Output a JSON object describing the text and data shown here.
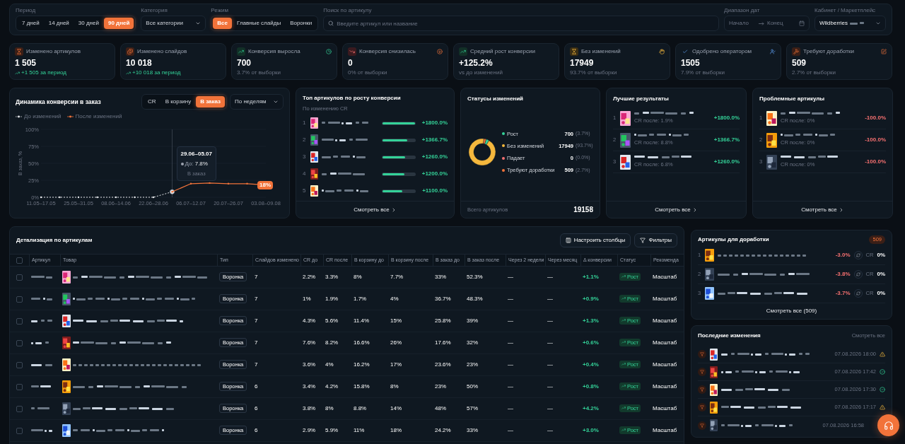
{
  "filters": {
    "period": {
      "label": "Период",
      "options": [
        {
          "label": "7 дней",
          "selected": false
        },
        {
          "label": "14 дней",
          "selected": false
        },
        {
          "label": "30 дней",
          "selected": false
        },
        {
          "label": "90 дней",
          "selected": true
        }
      ]
    },
    "category": {
      "label": "Категория",
      "value": "Все категории"
    },
    "mode": {
      "label": "Режим",
      "options": [
        {
          "label": "Все",
          "selected": true
        },
        {
          "label": "Главные слайды",
          "selected": false
        },
        {
          "label": "Воронки",
          "selected": false
        }
      ]
    },
    "search": {
      "label": "Поиск по артикулу",
      "placeholder": "Введите артикул или название"
    },
    "dates": {
      "label": "Диапазон дат",
      "start_placeholder": "Начало",
      "end_placeholder": "Конец"
    },
    "cabinet": {
      "label": "Кабинет / Маркетплейс",
      "value": "Wildberries"
    }
  },
  "stats": [
    {
      "label": "Изменено артикулов",
      "value": "1 505",
      "sub": "+1 505 за период",
      "kind": "growth"
    },
    {
      "label": "Изменено слайдов",
      "value": "10 018",
      "sub": "+10 018 за период",
      "kind": "growth"
    },
    {
      "label": "Конверсия выросла",
      "value": "700",
      "sub": "3.7% от выборки",
      "kind": "muted"
    },
    {
      "label": "Конверсия снизилась",
      "value": "0",
      "sub": "0% от выборки",
      "kind": "muted"
    },
    {
      "label": "Средний рост конверсии",
      "value": "+125.2%",
      "sub": "vs до изменений",
      "kind": "muted"
    },
    {
      "label": "Без изменений",
      "value": "17949",
      "sub": "93.7% от выборки",
      "kind": "muted"
    },
    {
      "label": "Одобрено оператором",
      "value": "1505",
      "sub": "7.9% от выборки",
      "kind": "muted"
    },
    {
      "label": "Требуют доработки",
      "value": "509",
      "sub": "2.7% от выборки",
      "kind": "muted"
    }
  ],
  "dynamics": {
    "title": "Динамика конверсии в заказ",
    "tabs": [
      {
        "label": "CR",
        "selected": false
      },
      {
        "label": "В корзину",
        "selected": false
      },
      {
        "label": "В заказ",
        "selected": true
      }
    ],
    "grouping": "По неделям",
    "tooltip": {
      "title": "29.06–05.07",
      "series_label": "До:",
      "value": "7.8%",
      "metric": "В заказ"
    },
    "chart_data": {
      "type": "line",
      "ylabel": "В заказ, %",
      "ylim": [
        0,
        100
      ],
      "categories": [
        "11.05–17.05",
        null,
        "25.05–31.05",
        null,
        "08.06–14.06",
        null,
        "22.06–28.06",
        null,
        "06.07–12.07",
        null,
        "20.07–26.07",
        null,
        "03.08–09.08"
      ],
      "yticks": [
        {
          "value": 0,
          "label": "0%"
        },
        {
          "value": 25,
          "label": "25%"
        },
        {
          "value": 50,
          "label": "50%"
        },
        {
          "value": 75,
          "label": "75%"
        },
        {
          "value": 100,
          "label": "100%"
        }
      ],
      "series": [
        {
          "name": "До изменений",
          "color": "#e5e7eb",
          "line_style": "dashed",
          "values": [
            0,
            0,
            0,
            0,
            0,
            0,
            0,
            8,
            null,
            null,
            null,
            null,
            null
          ]
        },
        {
          "name": "После изменений",
          "color": "#f2733a",
          "line_style": "solid",
          "values": [
            null,
            null,
            null,
            null,
            null,
            null,
            null,
            8,
            20,
            21,
            20,
            20,
            18
          ]
        }
      ],
      "annotations": [
        {
          "x": "03.08–09.08",
          "y": 18,
          "text": "18%"
        }
      ]
    }
  },
  "top_articles": {
    "title": "Топ артикулов по росту конверсии",
    "subtitle": "По изменению CR",
    "footer": "Смотреть все",
    "items": [
      {
        "rank": "1",
        "value": "+1800.0%",
        "level": 1
      },
      {
        "rank": "2",
        "value": "+1366.7%",
        "level": 0.76
      },
      {
        "rank": "3",
        "value": "+1260.0%",
        "level": 0.7
      },
      {
        "rank": "4",
        "value": "+1200.0%",
        "level": 0.67
      },
      {
        "rank": "5",
        "value": "+1100.0%",
        "level": 0.61
      }
    ]
  },
  "statuses": {
    "title": "Статусы изменений",
    "chart_data": {
      "type": "donut",
      "categories": [
        "Рост",
        "Без изменений",
        "Падает",
        "Требуют доработки"
      ],
      "values": [
        3.7,
        93.7,
        0,
        2.7
      ]
    },
    "legend": [
      {
        "count": "700",
        "share": "(3.7%)",
        "color": "#34d399"
      },
      {
        "count": "17949",
        "share": "(93.7%)",
        "color": "#f5b83d"
      },
      {
        "count": "0",
        "share": "(0.0%)",
        "color": "#f87171"
      },
      {
        "count": "509",
        "share": "(2.7%)",
        "color": "#f2733a"
      }
    ],
    "total_label": "Всего артикулов",
    "total": "19158"
  },
  "best": {
    "title": "Лучшие результаты",
    "footer": "Смотреть все",
    "kind": "growth",
    "items": [
      {
        "rank": "1",
        "cr": "CR после: 1.9%",
        "value": "+1800.0%"
      },
      {
        "rank": "2",
        "cr": "CR после: 8.8%",
        "value": "+1366.7%"
      },
      {
        "rank": "3",
        "cr": "CR после: 6.8%",
        "value": "+1260.0%"
      }
    ]
  },
  "problems": {
    "title": "Проблемные артикулы",
    "footer": "Смотреть все",
    "kind": "decline",
    "items": [
      {
        "rank": "1",
        "cr": "CR после: 0%",
        "value": "-100.0%"
      },
      {
        "rank": "2",
        "cr": "CR после: 0%",
        "value": "-100.0%"
      },
      {
        "rank": "3",
        "cr": "CR после: 0%",
        "value": "-100.0%"
      }
    ]
  },
  "details": {
    "title": "Детализация по артикулам",
    "buttons": [
      "Настроить столбцы",
      "Фильтры"
    ],
    "all_checked": false,
    "columns": [
      "Артикул",
      "Товар",
      "Тип",
      "Слайдов изменено",
      "CR до",
      "CR после",
      "В корзину до",
      "В корзину после",
      "В заказ до",
      "В заказ после",
      "Через 2 недели",
      "Через месяц",
      "Δ конверсии",
      "Статус",
      "Рекоменда"
    ],
    "rows": [
      {
        "checked": false,
        "kind": "growth",
        "cells": [
          null,
          null,
          "Воронка",
          "7",
          "2.2%",
          "3.3%",
          "8%",
          "7.7%",
          "33%",
          "52.3%",
          "—",
          "—",
          "+1.1%",
          "Рост",
          "Масштаб"
        ]
      },
      {
        "checked": false,
        "kind": "growth",
        "cells": [
          null,
          null,
          "Воронка",
          "7",
          "1%",
          "1.9%",
          "1.7%",
          "4%",
          "36.7%",
          "48.3%",
          "—",
          "—",
          "+0.9%",
          "Рост",
          "Масштаб"
        ]
      },
      {
        "checked": false,
        "kind": "growth",
        "cells": [
          null,
          null,
          "Воронка",
          "7",
          "4.3%",
          "5.6%",
          "11.4%",
          "15%",
          "25.8%",
          "39%",
          "—",
          "—",
          "+1.3%",
          "Рост",
          "Масштаб"
        ]
      },
      {
        "checked": false,
        "kind": "growth",
        "cells": [
          null,
          null,
          "Воронка",
          "7",
          "7.6%",
          "8.2%",
          "16.6%",
          "26%",
          "17.6%",
          "32%",
          "—",
          "—",
          "+0.6%",
          "Рост",
          "Масштаб"
        ]
      },
      {
        "checked": false,
        "kind": "growth",
        "cells": [
          null,
          null,
          "Воронка",
          "7",
          "3.6%",
          "4%",
          "16.2%",
          "17%",
          "23.6%",
          "23%",
          "—",
          "—",
          "+0.4%",
          "Рост",
          "Масштаб"
        ]
      },
      {
        "checked": false,
        "kind": "growth",
        "cells": [
          null,
          null,
          "Воронка",
          "6",
          "3.4%",
          "4.2%",
          "15.8%",
          "8%",
          "23%",
          "50%",
          "—",
          "—",
          "+0.8%",
          "Рост",
          "Масштаб"
        ]
      },
      {
        "checked": false,
        "kind": "growth",
        "cells": [
          null,
          null,
          "Воронка",
          "6",
          "3.8%",
          "8%",
          "8.8%",
          "14%",
          "48%",
          "57%",
          "—",
          "—",
          "+4.2%",
          "Рост",
          "Масштаб"
        ]
      },
      {
        "checked": false,
        "kind": "growth",
        "cells": [
          null,
          null,
          "Воронка",
          "6",
          "2.9%",
          "5.9%",
          "11%",
          "18%",
          "24.2%",
          "33%",
          "—",
          "—",
          "+3.0%",
          "Рост",
          "Масштаб"
        ]
      }
    ]
  },
  "rework": {
    "title": "Артикулы для доработки",
    "badge": "509",
    "footer": "Смотреть все (509)",
    "items": [
      {
        "rank": "1",
        "delta": "-3.0%",
        "cr_label": "CR",
        "cr": "0%"
      },
      {
        "rank": "2",
        "delta": "-3.8%",
        "cr_label": "CR",
        "cr": "0%"
      },
      {
        "rank": "3",
        "delta": "-3.7%",
        "cr_label": "CR",
        "cr": "0%"
      }
    ]
  },
  "recent": {
    "title": "Последние изменения",
    "link": "Смотреть все",
    "items": [
      {
        "date": "07.08.2026 18:00",
        "kind": "warning"
      },
      {
        "date": "07.08.2026 17:42",
        "kind": "ok"
      },
      {
        "date": "07.08.2026 17:30",
        "kind": "ok"
      },
      {
        "date": "07.08.2026 17:17",
        "kind": "warning"
      },
      {
        "date": "07.08.2026 16:58"
      }
    ]
  }
}
